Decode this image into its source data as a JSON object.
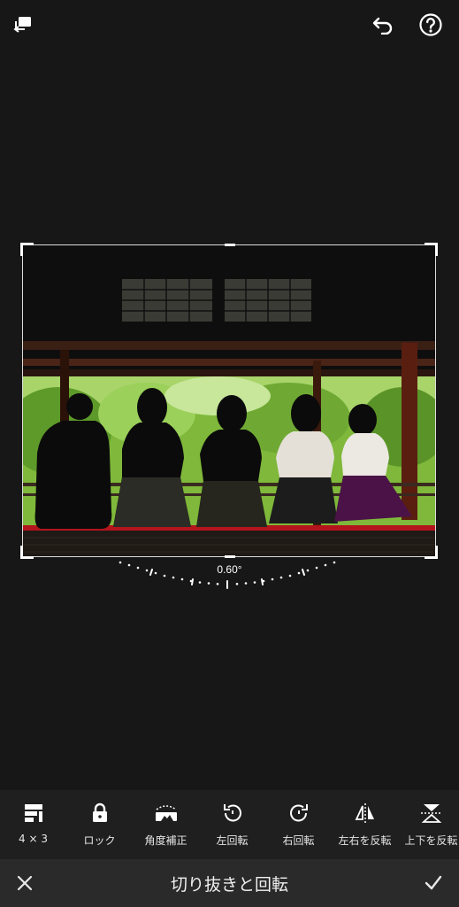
{
  "header": {
    "compare_icon": "compare-icon",
    "undo_icon": "undo-icon",
    "help_icon": "help-icon"
  },
  "crop": {
    "angle_label": "0.60°"
  },
  "tools": [
    {
      "label": "4 × 3",
      "icon": "aspect-ratio-icon"
    },
    {
      "label": "ロック",
      "icon": "lock-icon"
    },
    {
      "label": "角度補正",
      "icon": "straighten-icon"
    },
    {
      "label": "左回転",
      "icon": "rotate-left-icon"
    },
    {
      "label": "右回転",
      "icon": "rotate-right-icon"
    },
    {
      "label": "左右を反転",
      "icon": "flip-horizontal-icon"
    },
    {
      "label": "上下を反転",
      "icon": "flip-vertical-icon"
    }
  ],
  "footer": {
    "cancel_icon": "close-icon",
    "title": "切り抜きと回転",
    "confirm_icon": "check-icon"
  },
  "colors": {
    "background": "#171717",
    "toolbar": "#1f1f1f",
    "bottombar": "#2a2a2a",
    "foliage": "#8cc63f"
  }
}
